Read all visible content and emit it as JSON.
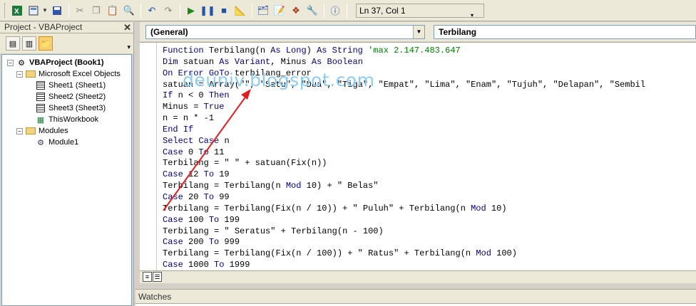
{
  "toolbar": {
    "status": "Ln 37, Col 1",
    "icons": [
      "excel-icon",
      "insert-module-icon",
      "save-icon",
      "cut-icon",
      "copy-icon",
      "paste-icon",
      "find-icon",
      "undo-icon",
      "redo-icon",
      "run-icon",
      "break-icon",
      "reset-icon",
      "design-mode-icon",
      "project-explorer-icon",
      "properties-icon",
      "object-browser-icon",
      "toolbox-icon",
      "help-icon"
    ]
  },
  "project": {
    "title": "Project - VBAProject",
    "root": "VBAProject (Book1)",
    "excel_objects": "Microsoft Excel Objects",
    "sheets": [
      "Sheet1 (Sheet1)",
      "Sheet2 (Sheet2)",
      "Sheet3 (Sheet3)",
      "ThisWorkbook"
    ],
    "modules_folder": "Modules",
    "module": "Module1"
  },
  "code": {
    "object_combo": "(General)",
    "proc_combo": "Terbilang",
    "lines": [
      "Function Terbilang(n As Long) As String 'max 2.147.483.647",
      "Dim satuan As Variant, Minus As Boolean",
      "On Error GoTo terbilang_error",
      "satuan = Array(\"\", \"Satu\", \"Dua\", \"Tiga\", \"Empat\", \"Lima\", \"Enam\", \"Tujuh\", \"Delapan\", \"Sembil",
      "If n < 0 Then",
      "Minus = True",
      "n = n * -1",
      "End If",
      "Select Case n",
      "Case 0 To 11",
      "Terbilang = \" \" + satuan(Fix(n))",
      "Case 12 To 19",
      "Terbilang = Terbilang(n Mod 10) + \" Belas\"",
      "Case 20 To 99",
      "Terbilang = Terbilang(Fix(n / 10)) + \" Puluh\" + Terbilang(n Mod 10)",
      "Case 100 To 199",
      "Terbilang = \" Seratus\" + Terbilang(n - 100)",
      "Case 200 To 999",
      "Terbilang = Terbilang(Fix(n / 100)) + \" Ratus\" + Terbilang(n Mod 100)",
      "Case 1000 To 1999"
    ]
  },
  "watermark": "deuniv.blogspot.com",
  "watches": {
    "title": "Watches"
  },
  "colors": {
    "keyword": "#000080",
    "comment": "#008000",
    "arrow": "#e02020",
    "watermark": "#8ecdf0"
  }
}
